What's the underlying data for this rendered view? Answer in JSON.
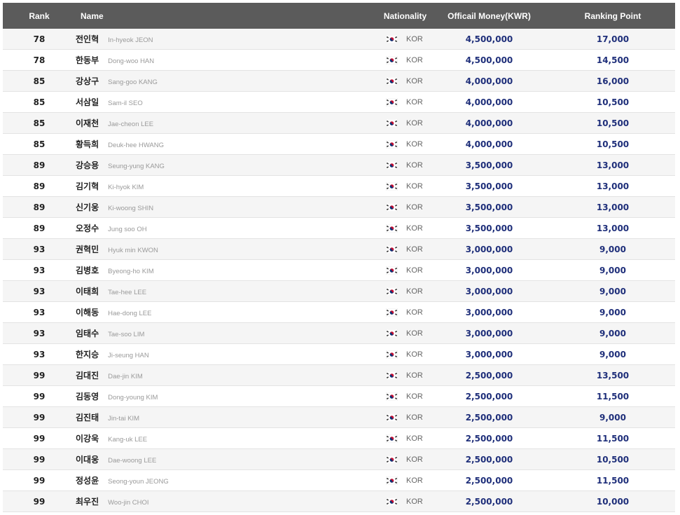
{
  "header": {
    "rank": "Rank",
    "name": "Name",
    "nationality": "Nationality",
    "money": "Officail Money(KWR)",
    "point": "Ranking Point"
  },
  "flag_icon": "korea-flag-icon",
  "colors": {
    "header_bg": "#5b5b5b",
    "value_text": "#1f2f7a"
  },
  "rows": [
    {
      "rank": "78",
      "kname": "전인혁",
      "ename": "In-hyeok JEON",
      "nat": "KOR",
      "money": "4,500,000",
      "point": "17,000"
    },
    {
      "rank": "78",
      "kname": "한동부",
      "ename": "Dong-woo HAN",
      "nat": "KOR",
      "money": "4,500,000",
      "point": "14,500"
    },
    {
      "rank": "85",
      "kname": "강상구",
      "ename": "Sang-goo KANG",
      "nat": "KOR",
      "money": "4,000,000",
      "point": "16,000"
    },
    {
      "rank": "85",
      "kname": "서삼일",
      "ename": "Sam-il SEO",
      "nat": "KOR",
      "money": "4,000,000",
      "point": "10,500"
    },
    {
      "rank": "85",
      "kname": "이재천",
      "ename": "Jae-cheon LEE",
      "nat": "KOR",
      "money": "4,000,000",
      "point": "10,500"
    },
    {
      "rank": "85",
      "kname": "황득희",
      "ename": "Deuk-hee HWANG",
      "nat": "KOR",
      "money": "4,000,000",
      "point": "10,500"
    },
    {
      "rank": "89",
      "kname": "강승용",
      "ename": "Seung-yung KANG",
      "nat": "KOR",
      "money": "3,500,000",
      "point": "13,000"
    },
    {
      "rank": "89",
      "kname": "김기혁",
      "ename": "Ki-hyok KIM",
      "nat": "KOR",
      "money": "3,500,000",
      "point": "13,000"
    },
    {
      "rank": "89",
      "kname": "신기웅",
      "ename": "Ki-woong SHIN",
      "nat": "KOR",
      "money": "3,500,000",
      "point": "13,000"
    },
    {
      "rank": "89",
      "kname": "오정수",
      "ename": "Jung soo OH",
      "nat": "KOR",
      "money": "3,500,000",
      "point": "13,000"
    },
    {
      "rank": "93",
      "kname": "권혁민",
      "ename": "Hyuk min KWON",
      "nat": "KOR",
      "money": "3,000,000",
      "point": "9,000"
    },
    {
      "rank": "93",
      "kname": "김병호",
      "ename": "Byeong-ho KIM",
      "nat": "KOR",
      "money": "3,000,000",
      "point": "9,000"
    },
    {
      "rank": "93",
      "kname": "이태희",
      "ename": "Tae-hee LEE",
      "nat": "KOR",
      "money": "3,000,000",
      "point": "9,000"
    },
    {
      "rank": "93",
      "kname": "이해동",
      "ename": "Hae-dong LEE",
      "nat": "KOR",
      "money": "3,000,000",
      "point": "9,000"
    },
    {
      "rank": "93",
      "kname": "임태수",
      "ename": "Tae-soo LIM",
      "nat": "KOR",
      "money": "3,000,000",
      "point": "9,000"
    },
    {
      "rank": "93",
      "kname": "한지승",
      "ename": "Ji-seung HAN",
      "nat": "KOR",
      "money": "3,000,000",
      "point": "9,000"
    },
    {
      "rank": "99",
      "kname": "김대진",
      "ename": "Dae-jin KIM",
      "nat": "KOR",
      "money": "2,500,000",
      "point": "13,500"
    },
    {
      "rank": "99",
      "kname": "김동영",
      "ename": "Dong-young KIM",
      "nat": "KOR",
      "money": "2,500,000",
      "point": "11,500"
    },
    {
      "rank": "99",
      "kname": "김진태",
      "ename": "Jin-tai KIM",
      "nat": "KOR",
      "money": "2,500,000",
      "point": "9,000"
    },
    {
      "rank": "99",
      "kname": "이강욱",
      "ename": "Kang-uk LEE",
      "nat": "KOR",
      "money": "2,500,000",
      "point": "11,500"
    },
    {
      "rank": "99",
      "kname": "이대웅",
      "ename": "Dae-woong LEE",
      "nat": "KOR",
      "money": "2,500,000",
      "point": "10,500"
    },
    {
      "rank": "99",
      "kname": "정성윤",
      "ename": "Seong-youn JEONG",
      "nat": "KOR",
      "money": "2,500,000",
      "point": "11,500"
    },
    {
      "rank": "99",
      "kname": "최우진",
      "ename": "Woo-jin CHOI",
      "nat": "KOR",
      "money": "2,500,000",
      "point": "10,000"
    }
  ]
}
